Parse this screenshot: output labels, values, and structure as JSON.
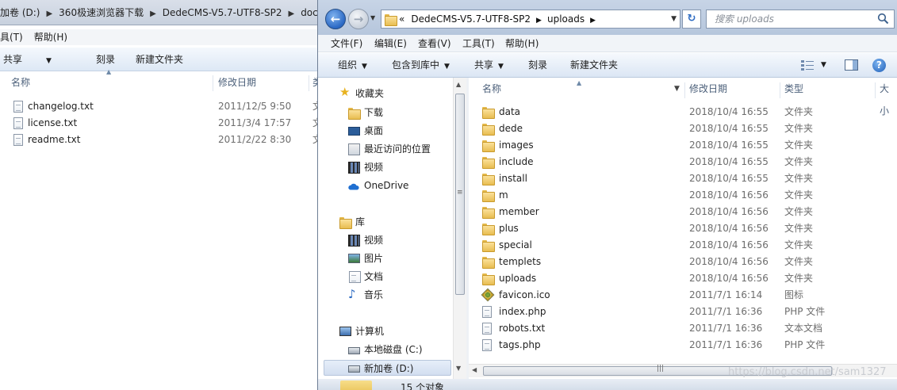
{
  "left_window": {
    "breadcrumbs": [
      "加卷 (D:)",
      "360极速浏览器下载",
      "DedeCMS-V5.7-UTF8-SP2",
      "doc"
    ],
    "menu": [
      "具(T)",
      "帮助(H)"
    ],
    "commands": [
      "共享",
      "刻录",
      "新建文件夹"
    ],
    "columns": {
      "name": "名称",
      "date": "修改日期",
      "type": "类"
    },
    "files": [
      {
        "name": "changelog.txt",
        "date": "2011/12/5 9:50",
        "type": "文"
      },
      {
        "name": "license.txt",
        "date": "2011/3/4 17:57",
        "type": "文"
      },
      {
        "name": "readme.txt",
        "date": "2011/2/22 8:30",
        "type": "文"
      }
    ]
  },
  "right_window": {
    "address": {
      "prefix": "«",
      "crumbs": [
        "DedeCMS-V5.7-UTF8-SP2",
        "uploads"
      ]
    },
    "search": {
      "placeholder": "搜索 uploads"
    },
    "menu": [
      "文件(F)",
      "编辑(E)",
      "查看(V)",
      "工具(T)",
      "帮助(H)"
    ],
    "commands": [
      "组织",
      "包含到库中",
      "共享",
      "刻录",
      "新建文件夹"
    ],
    "nav": {
      "favorites": "收藏夹",
      "favorite_items": [
        "下载",
        "桌面",
        "最近访问的位置",
        "视频",
        "OneDrive"
      ],
      "libraries": "库",
      "library_items": [
        "视频",
        "图片",
        "文档",
        "音乐"
      ],
      "computer": "计算机",
      "computer_items": [
        "本地磁盘 (C:)",
        "新加卷 (D:)"
      ]
    },
    "columns": {
      "name": "名称",
      "date": "修改日期",
      "type": "类型",
      "size": "大小"
    },
    "files": [
      {
        "name": "data",
        "date": "2018/10/4 16:55",
        "type": "文件夹",
        "icon": "folder-icon"
      },
      {
        "name": "dede",
        "date": "2018/10/4 16:55",
        "type": "文件夹",
        "icon": "folder-icon"
      },
      {
        "name": "images",
        "date": "2018/10/4 16:55",
        "type": "文件夹",
        "icon": "folder-icon"
      },
      {
        "name": "include",
        "date": "2018/10/4 16:55",
        "type": "文件夹",
        "icon": "folder-icon"
      },
      {
        "name": "install",
        "date": "2018/10/4 16:55",
        "type": "文件夹",
        "icon": "folder-icon"
      },
      {
        "name": "m",
        "date": "2018/10/4 16:56",
        "type": "文件夹",
        "icon": "folder-icon"
      },
      {
        "name": "member",
        "date": "2018/10/4 16:56",
        "type": "文件夹",
        "icon": "folder-icon"
      },
      {
        "name": "plus",
        "date": "2018/10/4 16:56",
        "type": "文件夹",
        "icon": "folder-icon"
      },
      {
        "name": "special",
        "date": "2018/10/4 16:56",
        "type": "文件夹",
        "icon": "folder-icon"
      },
      {
        "name": "templets",
        "date": "2018/10/4 16:56",
        "type": "文件夹",
        "icon": "folder-icon"
      },
      {
        "name": "uploads",
        "date": "2018/10/4 16:56",
        "type": "文件夹",
        "icon": "folder-icon"
      },
      {
        "name": "favicon.ico",
        "date": "2011/7/1 16:14",
        "type": "图标",
        "icon": "ico-file-icon"
      },
      {
        "name": "index.php",
        "date": "2011/7/1 16:36",
        "type": "PHP 文件",
        "icon": "php-file-icon"
      },
      {
        "name": "robots.txt",
        "date": "2011/7/1 16:36",
        "type": "文本文档",
        "icon": "text-file-icon"
      },
      {
        "name": "tags.php",
        "date": "2011/7/1 16:36",
        "type": "PHP 文件",
        "icon": "php-file-icon"
      }
    ],
    "status": {
      "item_count": "15 个对象"
    }
  },
  "watermark": "https://blog.csdn.net/sam1327"
}
